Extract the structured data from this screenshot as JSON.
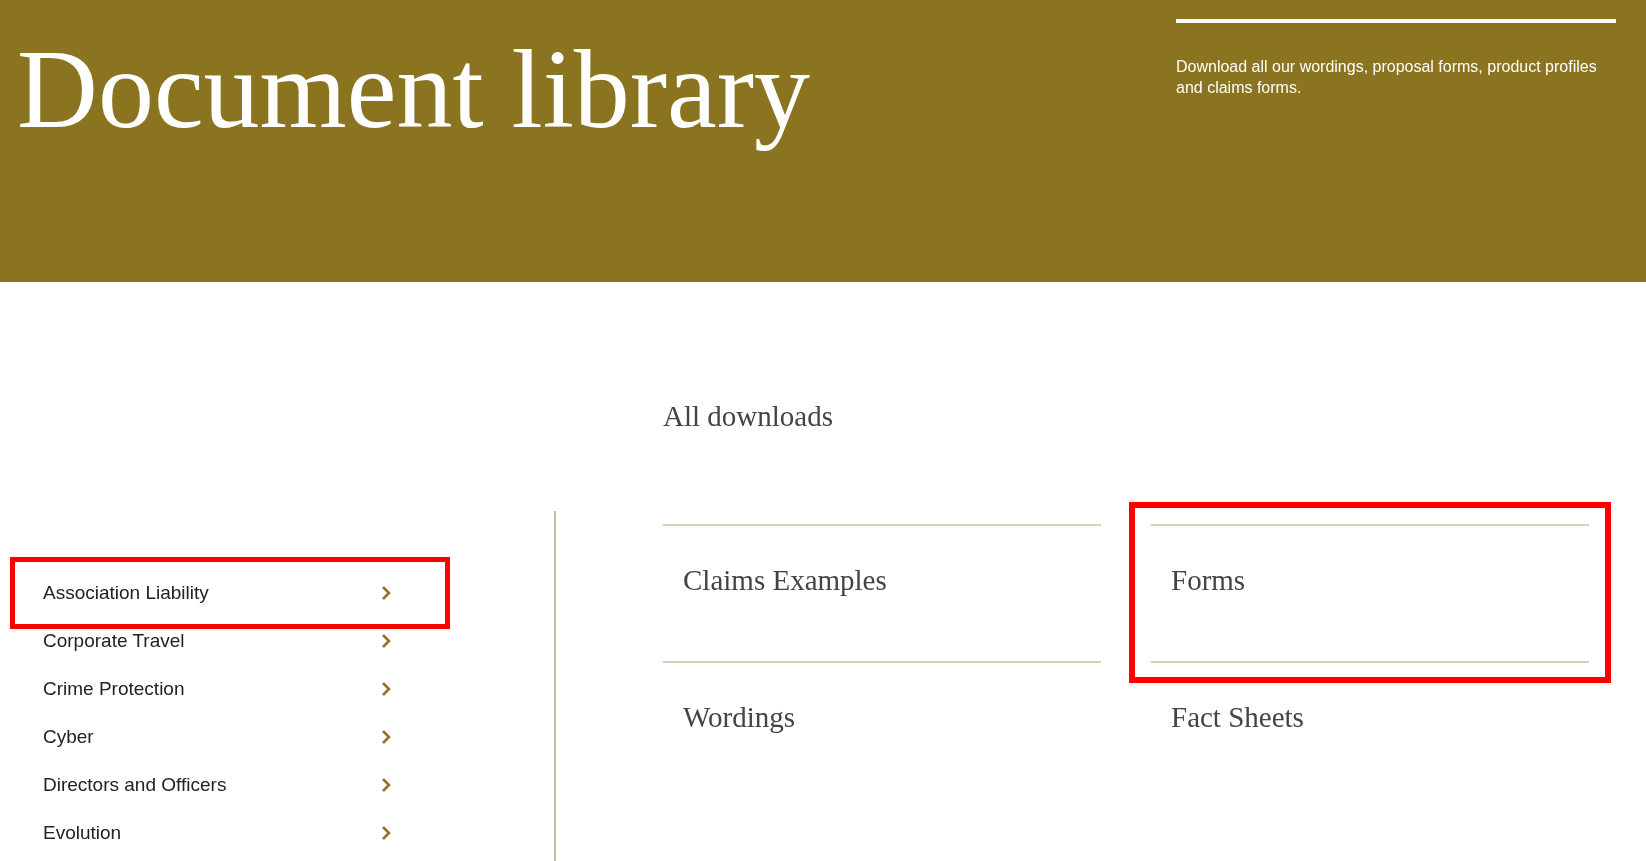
{
  "header": {
    "title": "Document library",
    "description": "Download all our wordings, proposal forms, product profiles and claims forms."
  },
  "section_title": "All downloads",
  "sidebar": {
    "items": [
      {
        "label": "Association Liability",
        "highlighted": true
      },
      {
        "label": "Corporate Travel",
        "highlighted": false
      },
      {
        "label": "Crime Protection",
        "highlighted": false
      },
      {
        "label": "Cyber",
        "highlighted": false
      },
      {
        "label": "Directors and Officers",
        "highlighted": false
      },
      {
        "label": "Evolution",
        "highlighted": false
      }
    ]
  },
  "categories": [
    {
      "label": "Claims Examples",
      "highlighted": false
    },
    {
      "label": "Forms",
      "highlighted": true
    },
    {
      "label": "Wordings",
      "highlighted": false
    },
    {
      "label": "Fact Sheets",
      "highlighted": false
    }
  ]
}
